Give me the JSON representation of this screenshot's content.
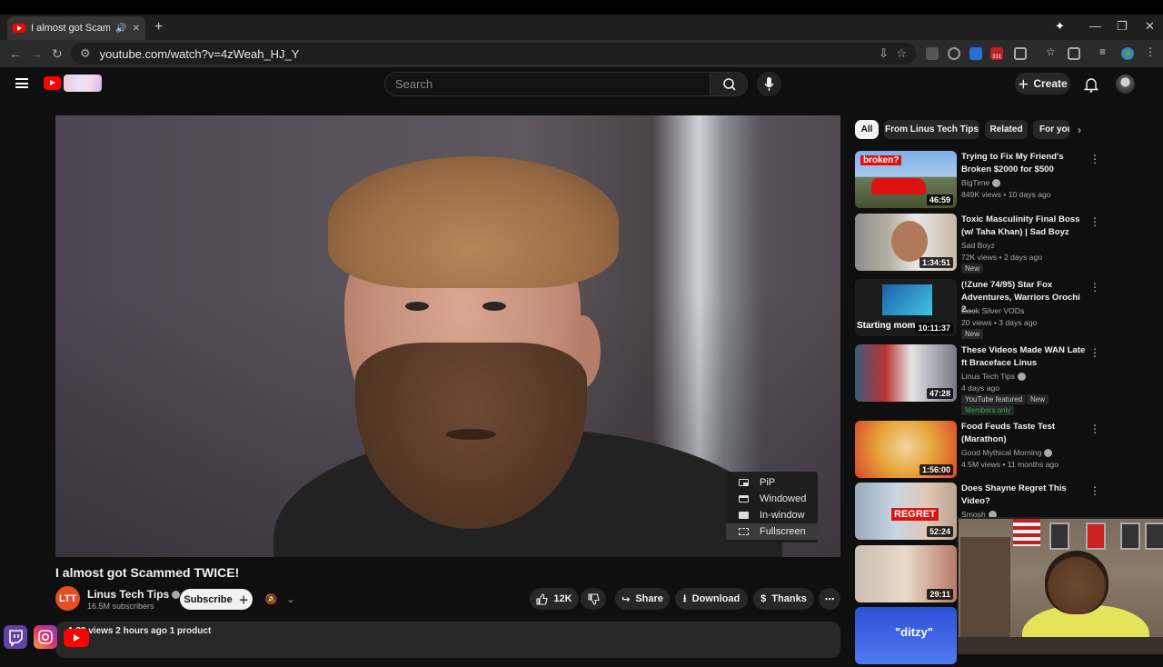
{
  "browser": {
    "tab_title": "I almost got Scammed TWICE!",
    "url": "youtube.com/watch?v=4zWeah_HJ_Y",
    "extension_badge": "331"
  },
  "header": {
    "search_placeholder": "Search",
    "create_label": "Create"
  },
  "player": {
    "menu": [
      "PiP",
      "Windowed",
      "In-window",
      "Fullscreen"
    ]
  },
  "video": {
    "title": "I almost got Scammed TWICE!",
    "channel": "Linus Tech Tips",
    "subscribers": "16.5M subscribers",
    "subscribe_label": "Subscribe",
    "likes": "12K",
    "share_label": "Share",
    "download_label": "Download",
    "thanks_label": "Thanks",
    "description_line": "1 82 views  2 hours ago  1 product"
  },
  "chips": [
    "All",
    "From Linus Tech Tips",
    "Related",
    "For you"
  ],
  "recommendations": [
    {
      "title": "Trying to Fix My Friend's Broken $2000 for $500",
      "channel": "BigTime",
      "meta": "849K views • 10 days ago",
      "duration": "46:59"
    },
    {
      "title": "Toxic Masculinity Final Boss (w/ Taha Khan) | Sad Boyz",
      "channel": "Sad Boyz",
      "meta": "72K views • 2 days ago",
      "duration": "1:34:51",
      "badge": "New"
    },
    {
      "title": "(!Zune 74/95)  Star Fox Adventures, Warriors Orochi 2,...",
      "channel": "Dook Silver VODs",
      "meta": "20 views • 3 days ago",
      "duration": "10:11:37",
      "badge": "New"
    },
    {
      "title": "These Videos Made WAN Late ft Braceface Linus",
      "channel": "Linus Tech Tips",
      "meta": "4 days ago",
      "duration": "47:28",
      "badge": "YouTube featured",
      "badge2": "New",
      "members": "Members only"
    },
    {
      "title": "Food Feuds Taste Test (Marathon)",
      "channel": "Good Mythical Morning",
      "meta": "4.5M views • 11 months ago",
      "duration": "1:56:00"
    },
    {
      "title": "Does Shayne Regret This Video?",
      "channel": "Smosh",
      "meta": "",
      "duration": "52:24"
    },
    {
      "title": "",
      "channel": "",
      "meta": "",
      "duration": "29:11"
    },
    {
      "title": "",
      "channel": "",
      "meta": "",
      "duration": ""
    }
  ],
  "thumb_text": {
    "broken": "broken?",
    "starting": "Starting mom",
    "regret": "REGRET",
    "ditzy": "\"ditzy\""
  },
  "colors": {
    "brand_red": "#ff0000",
    "bg": "#0f0f0f",
    "pill": "#272727",
    "members_green": "#2ba640"
  }
}
